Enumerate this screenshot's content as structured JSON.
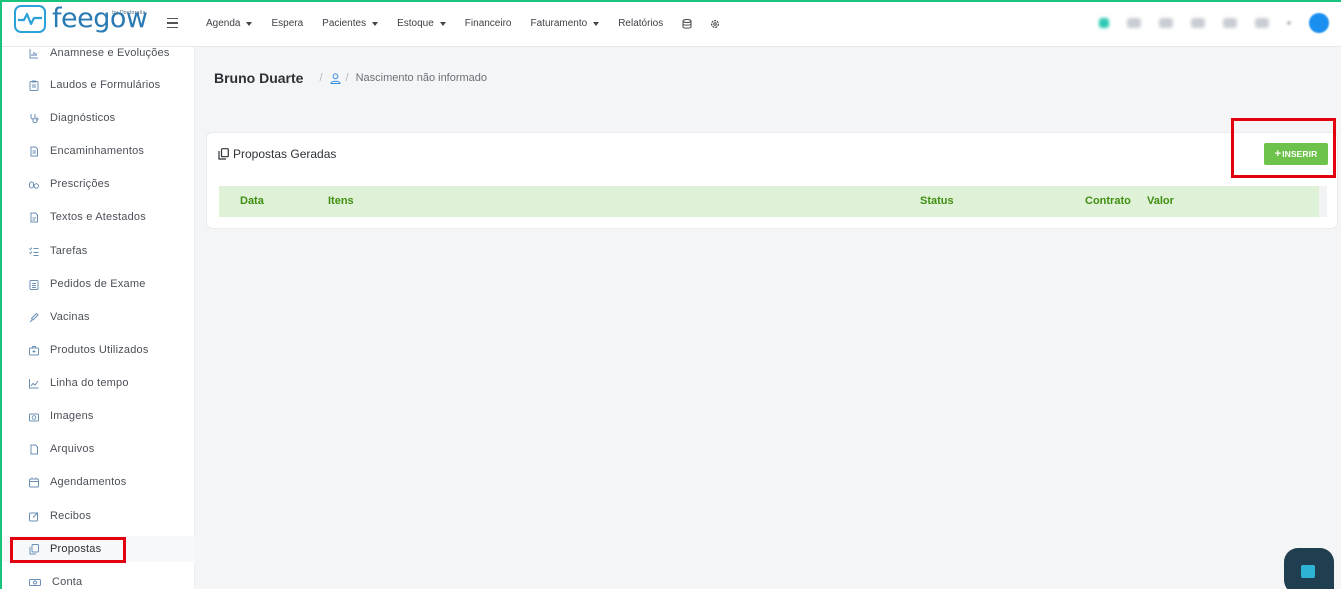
{
  "app": {
    "logo_text": "feegow",
    "logo_byline": "by Doctoralia"
  },
  "nav": {
    "items": [
      {
        "label": "Agenda",
        "dropdown": true
      },
      {
        "label": "Espera",
        "dropdown": false
      },
      {
        "label": "Pacientes",
        "dropdown": true
      },
      {
        "label": "Estoque",
        "dropdown": true
      },
      {
        "label": "Financeiro",
        "dropdown": false
      },
      {
        "label": "Faturamento",
        "dropdown": true
      },
      {
        "label": "Relatórios",
        "dropdown": false
      }
    ],
    "icons": [
      "database-icon",
      "gear-icon"
    ]
  },
  "sidebar": {
    "items": [
      {
        "label": "Anamnese e Evoluções",
        "icon": "chart-icon"
      },
      {
        "label": "Laudos e Formulários",
        "icon": "clipboard-icon"
      },
      {
        "label": "Diagnósticos",
        "icon": "stethoscope-icon"
      },
      {
        "label": "Encaminhamentos",
        "icon": "document-icon"
      },
      {
        "label": "Prescrições",
        "icon": "pills-icon"
      },
      {
        "label": "Textos e Atestados",
        "icon": "file-text-icon"
      },
      {
        "label": "Tarefas",
        "icon": "checklist-icon"
      },
      {
        "label": "Pedidos de Exame",
        "icon": "clipboard-list-icon"
      },
      {
        "label": "Vacinas",
        "icon": "syringe-icon"
      },
      {
        "label": "Produtos Utilizados",
        "icon": "medkit-icon"
      },
      {
        "label": "Linha do tempo",
        "icon": "line-chart-icon"
      },
      {
        "label": "Imagens",
        "icon": "camera-icon"
      },
      {
        "label": "Arquivos",
        "icon": "file-icon"
      },
      {
        "label": "Agendamentos",
        "icon": "calendar-icon"
      },
      {
        "label": "Recibos",
        "icon": "edit-icon"
      },
      {
        "label": "Propostas",
        "icon": "copy-icon",
        "active": true
      },
      {
        "label": "Conta",
        "icon": "money-icon"
      }
    ]
  },
  "breadcrumb": {
    "patient_name": "Bruno Duarte",
    "separator": "/",
    "birth_info": "Nascimento não informado"
  },
  "proposals": {
    "title": "Propostas Geradas",
    "insert_button": "INSERIR",
    "insert_plus": "+",
    "columns": [
      "Data",
      "Itens",
      "Status",
      "Contrato",
      "Valor"
    ]
  },
  "colors": {
    "accent_green": "#6cc24a",
    "table_header_bg": "#dff1d6",
    "table_header_text": "#3f8f12",
    "highlight_red": "#e3000f",
    "brand_blue": "#2a7ab3"
  }
}
